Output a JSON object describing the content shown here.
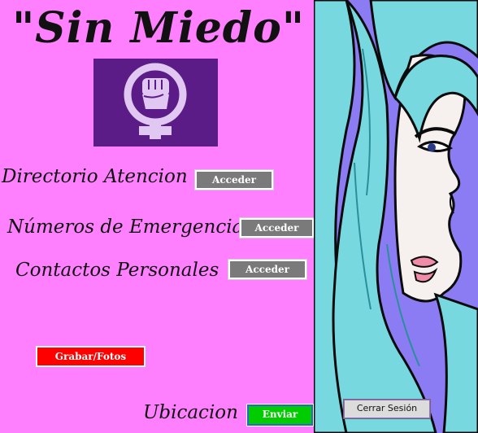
{
  "app": {
    "title": "\"Sin Miedo\""
  },
  "menu": {
    "directorio_label": "Directorio Atencion",
    "directorio_button": "Acceder",
    "emergencia_label": "Números de Emergencia",
    "emergencia_button": "Acceder",
    "contactos_label": "Contactos Personales",
    "contactos_button": "Acceder"
  },
  "actions": {
    "grabar_button": "Grabar/Fotos",
    "ubicacion_label": "Ubicacion",
    "enviar_button": "Enviar",
    "cerrar_sesion_button": "Cerrar Sesión"
  },
  "colors": {
    "background": "#ff80ff",
    "logo_bg": "#5c1c87",
    "logo_symbol": "#e0c8f2",
    "art_bg": "#8c7cf3",
    "hair": "#78d8e0",
    "skin": "#f6f1ee",
    "record_button": "#ff0000",
    "send_button": "#00cc00",
    "access_button": "#7a7a7a"
  }
}
